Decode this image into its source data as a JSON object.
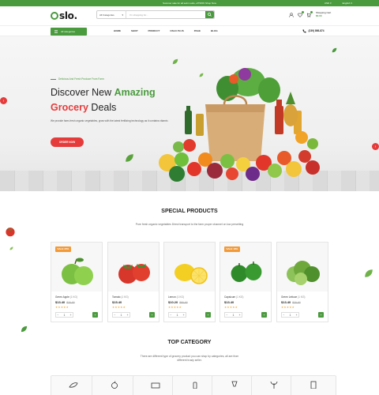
{
  "topbar": {
    "message": "Summer sale for all swim suits, off 50%! Shop Now",
    "currency": "USD",
    "language": "English"
  },
  "header": {
    "logo_text": "slo.",
    "search": {
      "category": "All Categories",
      "placeholder": "I'm shopping for..."
    },
    "cart": {
      "label": "Shopping Cart",
      "amount": "$0.00"
    }
  },
  "nav": {
    "all_categories": "All categories",
    "links": [
      "HOME",
      "SHOP",
      "PRODUCT",
      "OSLO PLUS",
      "PAGE",
      "BLOG"
    ],
    "phone": "(239) 898-874"
  },
  "hero": {
    "tagline": "Delicious And Fresh Produce From Farm",
    "title_line1_plain": "Discover New ",
    "title_line1_accent": "Amazing",
    "title_line2_accent": "Grocery",
    "title_line2_plain": " Deals",
    "description": "We provide farm-fresh organic vegetables, grow with the latest fertilizing technology as it contains vitamin.",
    "button": "ORDER NOW"
  },
  "special": {
    "title": "SPECIAL PRODUCTS",
    "subtitle": "Pure fresh organic vegetables Direct transport to the farm proper channel on low persetting"
  },
  "products": [
    {
      "name": "Green Apple",
      "unit": "(1 KG)",
      "price": "$13.40",
      "old_price": "$20.00",
      "badge": "SALE 20%",
      "qty": "1"
    },
    {
      "name": "Tomato",
      "unit": "(1 KG)",
      "price": "$15.40",
      "old_price": "",
      "badge": "",
      "qty": "1"
    },
    {
      "name": "Lemon",
      "unit": "(1 KG)",
      "price": "$10.20",
      "old_price": "$80.00",
      "badge": "",
      "qty": "1"
    },
    {
      "name": "Capsicum",
      "unit": "(1 KG)",
      "price": "$13.40",
      "old_price": "",
      "badge": "SALE 18%",
      "qty": "1"
    },
    {
      "name": "Green Lettuce",
      "unit": "(1 KG)",
      "price": "$13.40",
      "old_price": "$20.00",
      "badge": "",
      "qty": "1"
    }
  ],
  "top_category": {
    "title": "TOP CATEGORY",
    "subtitle": "There are different type of grocery product you can shop by categories, all are from different trusty seller."
  },
  "colors": {
    "brand_green": "#4a9a3e",
    "accent_red": "#e63b3b",
    "sale_orange": "#f29a38",
    "star": "#f2a93b"
  },
  "icons": [
    "search-icon",
    "heart-icon",
    "user-icon",
    "cart-icon",
    "menu-icon",
    "phone-icon",
    "leaf-icon",
    "arrow-left-icon",
    "arrow-right-icon"
  ]
}
